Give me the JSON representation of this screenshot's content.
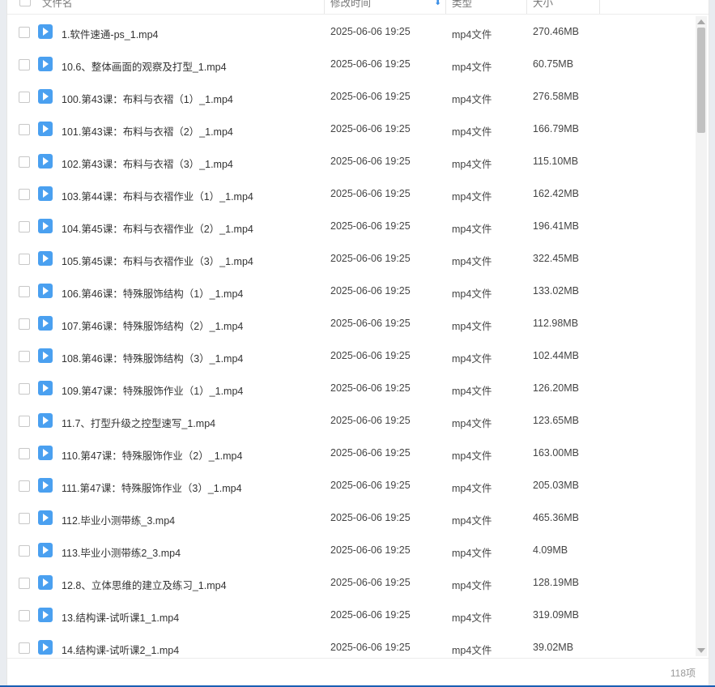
{
  "header": {
    "name_label": "文件名",
    "time_label": "修改时间",
    "type_label": "类型",
    "size_label": "大小"
  },
  "files": [
    {
      "name": "1.软件速通-ps_1.mp4",
      "time": "2025-06-06 19:25",
      "type": "mp4文件",
      "size": "270.46MB"
    },
    {
      "name": "10.6、整体画面的观察及打型_1.mp4",
      "time": "2025-06-06 19:25",
      "type": "mp4文件",
      "size": "60.75MB"
    },
    {
      "name": "100.第43课：布料与衣褶（1）_1.mp4",
      "time": "2025-06-06 19:25",
      "type": "mp4文件",
      "size": "276.58MB"
    },
    {
      "name": "101.第43课：布料与衣褶（2）_1.mp4",
      "time": "2025-06-06 19:25",
      "type": "mp4文件",
      "size": "166.79MB"
    },
    {
      "name": "102.第43课：布料与衣褶（3）_1.mp4",
      "time": "2025-06-06 19:25",
      "type": "mp4文件",
      "size": "115.10MB"
    },
    {
      "name": "103.第44课：布料与衣褶作业（1）_1.mp4",
      "time": "2025-06-06 19:25",
      "type": "mp4文件",
      "size": "162.42MB"
    },
    {
      "name": "104.第45课：布料与衣褶作业（2）_1.mp4",
      "time": "2025-06-06 19:25",
      "type": "mp4文件",
      "size": "196.41MB"
    },
    {
      "name": "105.第45课：布料与衣褶作业（3）_1.mp4",
      "time": "2025-06-06 19:25",
      "type": "mp4文件",
      "size": "322.45MB"
    },
    {
      "name": "106.第46课：特殊服饰结构（1）_1.mp4",
      "time": "2025-06-06 19:25",
      "type": "mp4文件",
      "size": "133.02MB"
    },
    {
      "name": "107.第46课：特殊服饰结构（2）_1.mp4",
      "time": "2025-06-06 19:25",
      "type": "mp4文件",
      "size": "112.98MB"
    },
    {
      "name": "108.第46课：特殊服饰结构（3）_1.mp4",
      "time": "2025-06-06 19:25",
      "type": "mp4文件",
      "size": "102.44MB"
    },
    {
      "name": "109.第47课：特殊服饰作业（1）_1.mp4",
      "time": "2025-06-06 19:25",
      "type": "mp4文件",
      "size": "126.20MB"
    },
    {
      "name": "11.7、打型升级之控型速写_1.mp4",
      "time": "2025-06-06 19:25",
      "type": "mp4文件",
      "size": "123.65MB"
    },
    {
      "name": "110.第47课：特殊服饰作业（2）_1.mp4",
      "time": "2025-06-06 19:25",
      "type": "mp4文件",
      "size": "163.00MB"
    },
    {
      "name": "111.第47课：特殊服饰作业（3）_1.mp4",
      "time": "2025-06-06 19:25",
      "type": "mp4文件",
      "size": "205.03MB"
    },
    {
      "name": "112.毕业小测带练_3.mp4",
      "time": "2025-06-06 19:25",
      "type": "mp4文件",
      "size": "465.36MB"
    },
    {
      "name": "113.毕业小测带练2_3.mp4",
      "time": "2025-06-06 19:25",
      "type": "mp4文件",
      "size": "4.09MB"
    },
    {
      "name": "12.8、立体思维的建立及练习_1.mp4",
      "time": "2025-06-06 19:25",
      "type": "mp4文件",
      "size": "128.19MB"
    },
    {
      "name": "13.结构课-试听课1_1.mp4",
      "time": "2025-06-06 19:25",
      "type": "mp4文件",
      "size": "319.09MB"
    },
    {
      "name": "14.结构课-试听课2_1.mp4",
      "time": "2025-06-06 19:25",
      "type": "mp4文件",
      "size": "39.02MB"
    }
  ],
  "footer": {
    "count": "118项"
  }
}
